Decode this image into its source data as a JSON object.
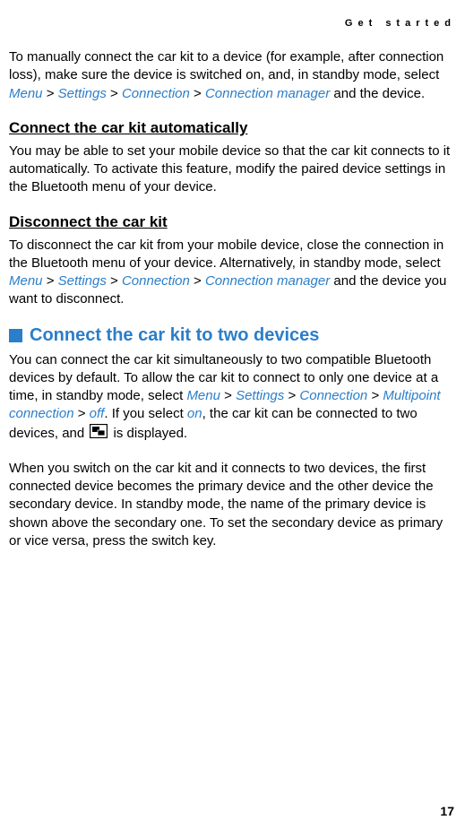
{
  "header": "Get started",
  "para1": {
    "text1": "To manually connect the car kit to a device (for example, after connection loss), make sure the device is switched on, and, in standby mode, select ",
    "menu": "Menu",
    "gt1": " > ",
    "settings": "Settings",
    "gt2": " > ",
    "connection": "Connection",
    "gt3": " > ",
    "connmgr": "Connection manager",
    "text2": " and the device."
  },
  "sub1": "Connect the car kit automatically",
  "para2": "You may be able to set your mobile device so that the car kit connects to it automatically. To activate this feature, modify the paired device settings in the Bluetooth menu of your device.",
  "sub2": "Disconnect the car kit",
  "para3": {
    "text1": "To disconnect the car kit from your mobile device, close the connection in the Bluetooth menu of your device. Alternatively, in standby mode, select ",
    "menu": "Menu",
    "gt1": " > ",
    "settings": "Settings",
    "gt2": " > ",
    "connection": "Connection",
    "gt3": " > ",
    "connmgr": "Connection manager",
    "text2": " and the device you want to disconnect."
  },
  "section_heading": "Connect the car kit to two devices",
  "para4": {
    "text1": "You can connect the car kit simultaneously to two compatible Bluetooth devices by default. To allow the car kit to connect to only one device at a time, in standby mode, select ",
    "menu": "Menu",
    "gt1": " > ",
    "settings": "Settings",
    "gt2": " > ",
    "connection": "Connection",
    "gt3": " > ",
    "multipoint": "Multipoint connection",
    "gt4": " > ",
    "off": "off",
    "text2": ". If you select ",
    "on": "on",
    "text3": ", the car kit can be connected to two devices, and ",
    "text4": " is displayed."
  },
  "para5": "When you switch on the car kit and it connects to two devices, the first connected device becomes the primary device and the other device the secondary device. In standby mode, the name of the primary device is shown above the secondary one. To set the secondary device as primary or vice versa, press the switch key.",
  "page_number": "17"
}
